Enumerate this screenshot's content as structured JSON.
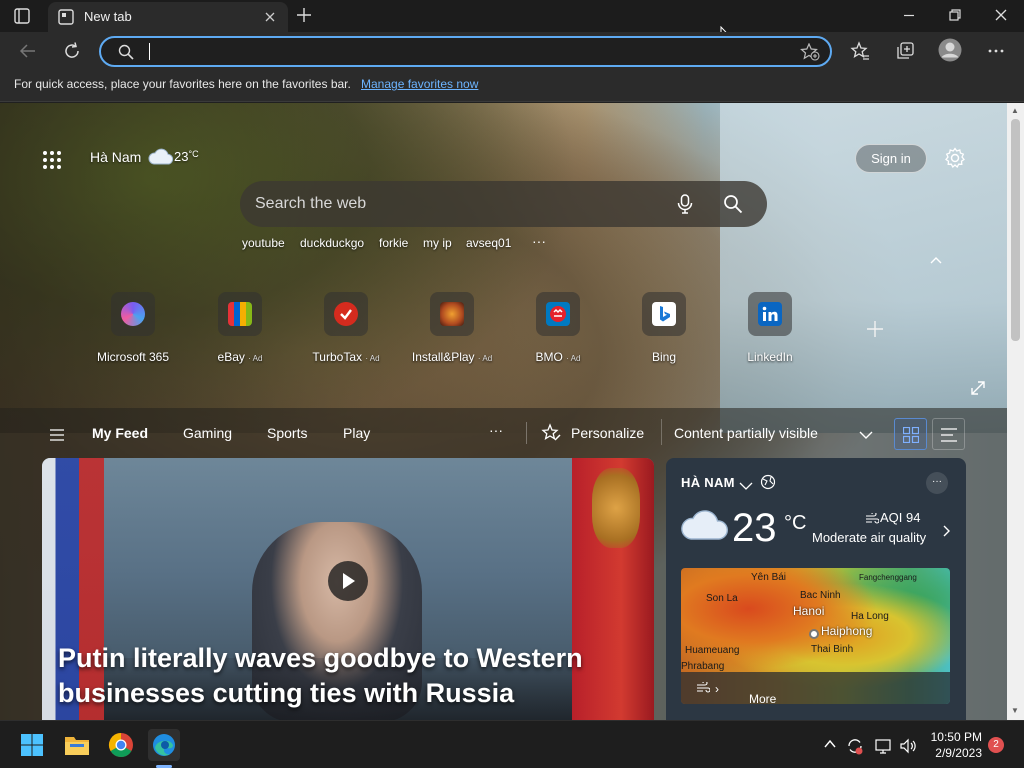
{
  "tab": {
    "title": "New tab"
  },
  "omnibox": {
    "value": ""
  },
  "favorites_bar": {
    "message": "For quick access, place your favorites here on the favorites bar.",
    "link": "Manage favorites now"
  },
  "ntp": {
    "location": "Hà Nam",
    "temp": "23",
    "temp_unit": "°C",
    "sign_in": "Sign in",
    "search_placeholder": "Search the web",
    "quick_links": [
      "youtube",
      "duckduckgo",
      "forkie",
      "my ip",
      "avseq01"
    ],
    "more_quick_links": "···",
    "tiles": [
      {
        "label": "Microsoft 365",
        "ad": "",
        "color": "#6b4df0",
        "icon": "m365-icon"
      },
      {
        "label": "eBay",
        "ad": "· Ad",
        "color": "#e53238",
        "icon": "ebay-icon"
      },
      {
        "label": "TurboTax",
        "ad": "· Ad",
        "color": "#d52b1e",
        "icon": "turbotax-icon"
      },
      {
        "label": "Install&Play",
        "ad": "· Ad",
        "color": "#b04a20",
        "icon": "installplay-icon"
      },
      {
        "label": "BMO",
        "ad": "· Ad",
        "color": "#0079c1",
        "icon": "bmo-icon"
      },
      {
        "label": "Bing",
        "ad": "",
        "color": "#ffffff",
        "icon": "bing-icon"
      },
      {
        "label": "LinkedIn",
        "ad": "",
        "color": "#0a66c2",
        "icon": "linkedin-icon"
      }
    ]
  },
  "feed": {
    "tabs": [
      "My Feed",
      "Gaming",
      "Sports",
      "Play"
    ],
    "more": "···",
    "personalize": "Personalize",
    "visibility": "Content partially visible"
  },
  "hero": {
    "headline": "Putin literally waves goodbye to Western businesses cutting ties with Russia"
  },
  "weather_card": {
    "location": "HÀ NAM",
    "temp": "23",
    "unit": "°C",
    "aqi": "AQI 94",
    "aqi_desc": "Moderate air quality",
    "map_labels": {
      "yen_bai": "Yên Bái",
      "fangchenggang": "Fangchenggang",
      "son_la": "Son La",
      "bac_ninh": "Bac Ninh",
      "hanoi": "Hanoi",
      "ha_long": "Ha Long",
      "haiphong": "Haiphong",
      "huameuang": "Huameuang",
      "thai_binh": "Thai Binh",
      "phrabang": "Phrabang"
    },
    "more_link": "More AQ info nearby"
  },
  "taskbar": {
    "time": "10:50 PM",
    "date": "2/9/2023",
    "notifications": "2"
  }
}
